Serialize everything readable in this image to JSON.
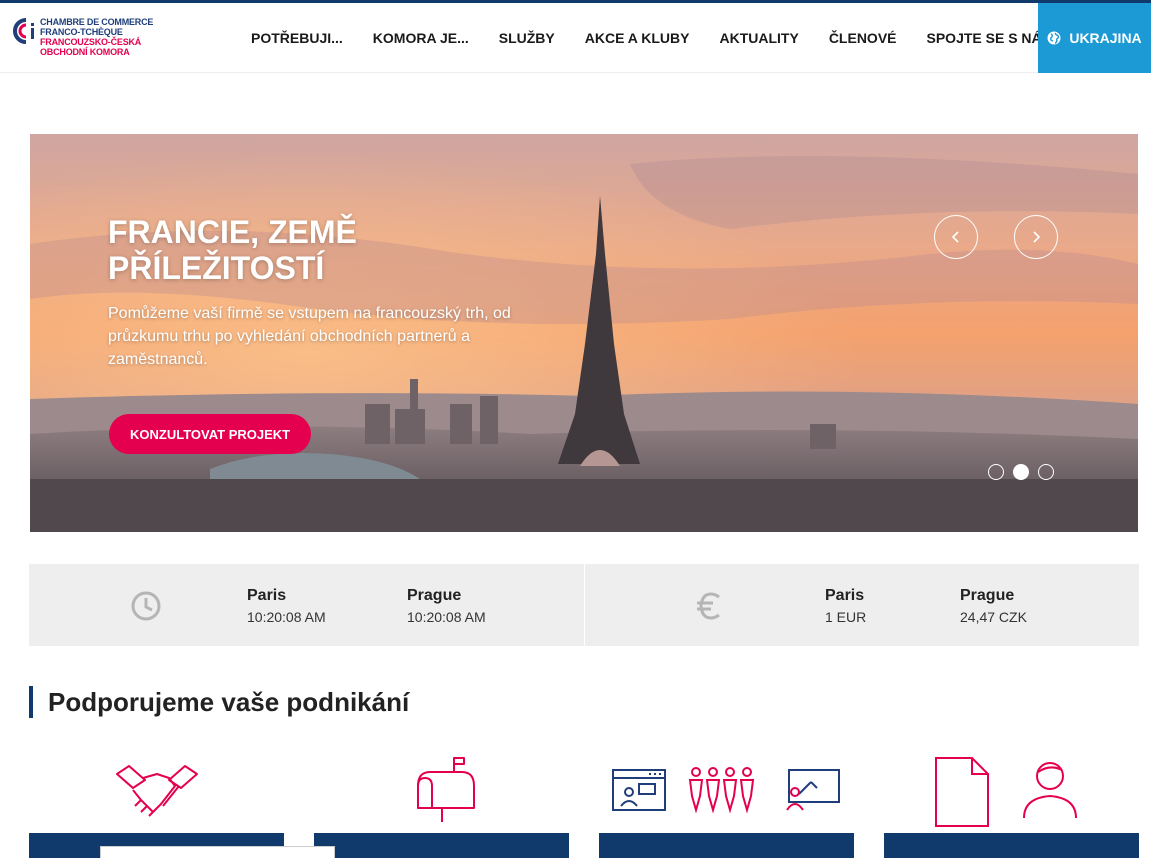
{
  "brand": {
    "line1": "CHAMBRE DE COMMERCE",
    "line2": "FRANCO-TCHÈQUE",
    "line3": "FRANCOUZSKO-ČESKÁ",
    "line4": "OBCHODNÍ KOMORA",
    "colors": {
      "navy": "#1f3e7a",
      "pink": "#e4004f",
      "blue": "#1c9ad6"
    }
  },
  "nav": {
    "items": [
      "POTŘEBUJI...",
      "KOMORA JE...",
      "SLUŽBY",
      "AKCE A KLUBY",
      "AKTUALITY",
      "ČLENOVÉ",
      "SPOJTE SE S NÁMI"
    ],
    "cta": "UKRAJINA",
    "cta_icon": "globe-icon"
  },
  "hero": {
    "title": "FRANCIE, ZEMĚ PŘÍLEŽITOSTÍ",
    "text": "Pomůžeme vaší firmě se vstupem na francouzský trh, od průzkumu trhu po vyhledání obchodních partnerů a zaměstnanců.",
    "button": "KONZULTOVAT PROJEKT",
    "slides_count": 3,
    "active_slide": 2
  },
  "info": {
    "time": {
      "icon": "clock-icon",
      "cities": [
        {
          "city": "Paris",
          "value": "10:20:08 AM"
        },
        {
          "city": "Prague",
          "value": "10:20:08 AM"
        }
      ]
    },
    "currency": {
      "icon": "euro-icon",
      "cities": [
        {
          "city": "Paris",
          "value": "1 EUR"
        },
        {
          "city": "Prague",
          "value": "24,47 CZK"
        }
      ]
    }
  },
  "section": {
    "title": "Podporujeme vaše podnikání",
    "cards": [
      {
        "icons": [
          "handshake-icon"
        ]
      },
      {
        "icons": [
          "mailbox-icon"
        ]
      },
      {
        "icons": [
          "webinar-icon",
          "people-group-icon",
          "presentation-icon"
        ]
      },
      {
        "icons": [
          "document-icon",
          "person-icon"
        ]
      }
    ]
  }
}
